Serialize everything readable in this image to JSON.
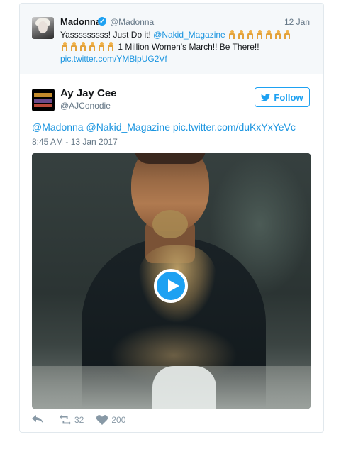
{
  "quoted_tweet": {
    "name": "Madonna",
    "handle": "@Madonna",
    "date": "12 Jan",
    "text_start": "Yasssssssss! Just Do it! ",
    "mention": "@Nakid_Magazine",
    "text_end": " 1 Million Women's March!! Be There!!",
    "link": "pic.twitter.com/YMBlpUG2Vf"
  },
  "main_tweet": {
    "name": "Ay Jay Cee",
    "handle": "@AJConodie",
    "follow_label": "Follow",
    "text": "@Madonna @Nakid_Magazine pic.twitter.com/duKxYxYeVc",
    "timestamp": "8:45 AM - 13 Jan 2017"
  },
  "actions": {
    "retweets": "32",
    "likes": "200"
  },
  "icons": [
    "verified-icon",
    "twitter-bird-icon",
    "play-icon",
    "reply-icon",
    "retweet-icon",
    "heart-icon"
  ],
  "colors": {
    "accent": "#1da1f2",
    "link": "#1b95e0",
    "muted": "#657786"
  }
}
